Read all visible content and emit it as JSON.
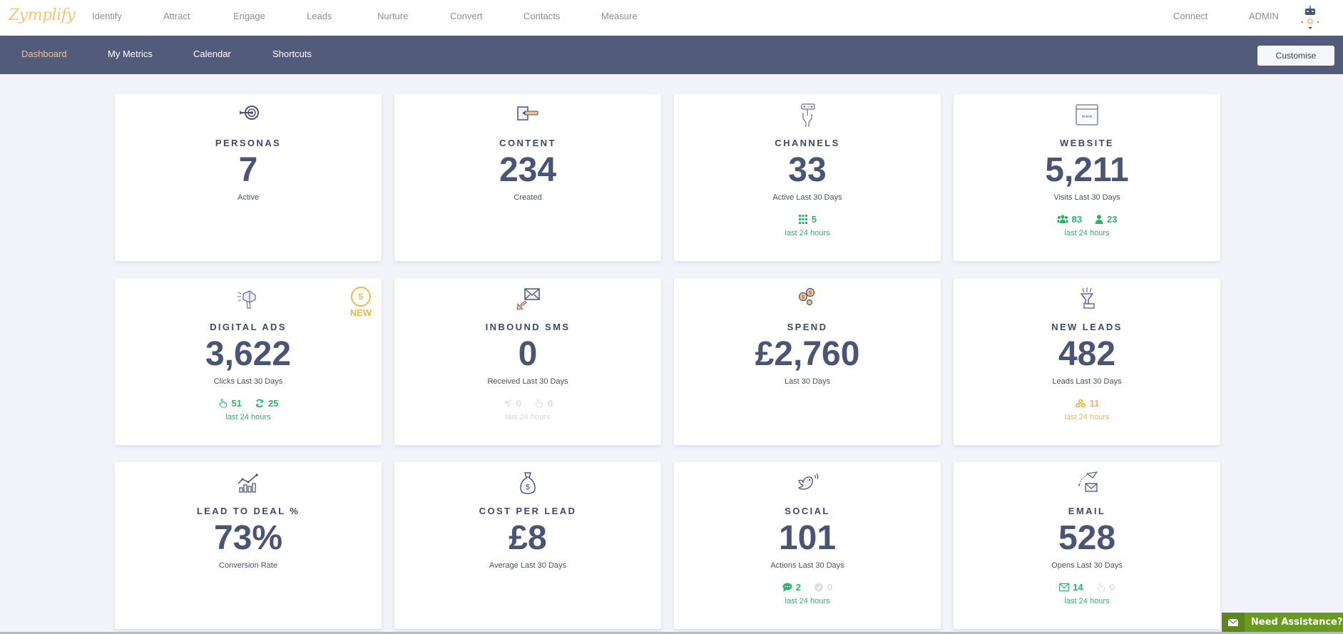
{
  "app": {
    "logo": "Zymplify"
  },
  "topnav": {
    "items": [
      "Identify",
      "Attract",
      "Engage",
      "Leads",
      "Nurture",
      "Convert",
      "Contacts",
      "Measure"
    ],
    "connect": "Connect",
    "user": "ADMIN",
    "avatar_icon": "robot-avatar-icon"
  },
  "subnav": {
    "items": [
      "Dashboard",
      "My Metrics",
      "Calendar",
      "Shortcuts"
    ],
    "active": "Dashboard",
    "customise_label": "Customise"
  },
  "colors": {
    "accent_orange": "#f4b650",
    "subnav_bg": "#525c7a",
    "stat_green": "#2ab36b",
    "assist_green": "#6a9a1e",
    "value_navy": "#4a5476"
  },
  "cards": [
    {
      "id": "personas",
      "icon": "target-arrow-icon",
      "title": "PERSONAS",
      "value": "7",
      "caption": "Active"
    },
    {
      "id": "content",
      "icon": "pencil-paper-icon",
      "title": "CONTENT",
      "value": "234",
      "caption": "Created"
    },
    {
      "id": "channels",
      "icon": "hand-remote-icon",
      "title": "CHANNELS",
      "value": "33",
      "caption": "Active Last 30 Days",
      "stats": [
        {
          "icon": "grid-icon",
          "value": "5"
        }
      ],
      "stats_label": "last 24 hours"
    },
    {
      "id": "website",
      "icon": "browser-window-icon",
      "title": "WEBSITE",
      "value": "5,211",
      "caption": "Visits Last 30 Days",
      "stats": [
        {
          "icon": "users-icon",
          "value": "83"
        },
        {
          "icon": "user-icon",
          "value": "23"
        }
      ],
      "stats_label": "last 24 hours"
    },
    {
      "id": "digital-ads",
      "icon": "megaphone-icon",
      "title": "DIGITAL ADS",
      "value": "3,622",
      "caption": "Clicks Last 30 Days",
      "badge": {
        "count": "5",
        "label": "NEW"
      },
      "stats": [
        {
          "icon": "pointer-hand-icon",
          "value": "51"
        },
        {
          "icon": "refresh-icon",
          "value": "25"
        }
      ],
      "stats_label": "last 24 hours"
    },
    {
      "id": "inbound-sms",
      "icon": "envelope-arrow-icon",
      "title": "INBOUND SMS",
      "value": "0",
      "caption": "Received Last 30 Days",
      "stats": [
        {
          "icon": "paper-plane-icon",
          "value": "0"
        },
        {
          "icon": "pointer-hand-icon",
          "value": "0"
        }
      ],
      "stats_label": "last 24 hours"
    },
    {
      "id": "spend",
      "icon": "coins-icon",
      "title": "SPEND",
      "value": "£2,760",
      "caption": "Last 30 Days"
    },
    {
      "id": "new-leads",
      "icon": "funnel-hand-icon",
      "title": "NEW LEADS",
      "value": "482",
      "caption": "Leads Last 30 Days",
      "stats": [
        {
          "icon": "cubes-icon",
          "value": "11"
        }
      ],
      "stats_label": "last 24 hours"
    },
    {
      "id": "lead-to-deal",
      "icon": "chart-growth-icon",
      "title": "LEAD TO DEAL %",
      "value": "73%",
      "caption": "Conversion Rate"
    },
    {
      "id": "cost-per-lead",
      "icon": "money-bag-icon",
      "title": "COST PER LEAD",
      "value": "£8",
      "caption": "Average Last 30 Days"
    },
    {
      "id": "social",
      "icon": "bird-icon",
      "title": "SOCIAL",
      "value": "101",
      "caption": "Actions Last 30 Days",
      "stats": [
        {
          "icon": "comment-icon",
          "value": "2"
        },
        {
          "icon": "check-circle-icon",
          "value": "0"
        }
      ],
      "stats_label": "last 24 hours"
    },
    {
      "id": "email",
      "icon": "envelope-plane-icon",
      "title": "EMAIL",
      "value": "528",
      "caption": "Opens Last 30 Days",
      "stats": [
        {
          "icon": "envelope-icon",
          "value": "14"
        },
        {
          "icon": "pointer-hand-icon",
          "value": "0"
        }
      ],
      "stats_label": "last 24 hours"
    }
  ],
  "assistance": {
    "label": "Need Assistance?"
  }
}
